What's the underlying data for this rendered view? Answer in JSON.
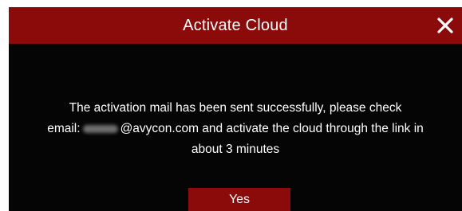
{
  "dialog": {
    "title": "Activate Cloud",
    "close_icon": "close-icon",
    "message": {
      "line1": "The activation mail has been sent successfully, please check",
      "line2_prefix": "email:",
      "line2_suffix": "@avycon.com and activate the cloud through the link in",
      "line3": "about 3 minutes"
    },
    "yes_label": "Yes"
  },
  "colors": {
    "titlebar": "#8b0b0b",
    "background": "#050505",
    "text": "#ffffff",
    "button": "#8b0b0b"
  }
}
